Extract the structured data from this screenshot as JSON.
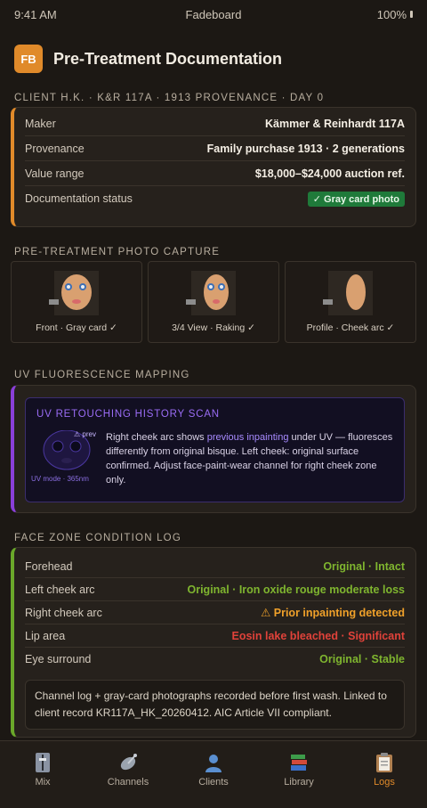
{
  "status": {
    "time": "9:41 AM",
    "app_name": "Fadeboard",
    "battery": "100%"
  },
  "header": {
    "logo": "FB",
    "title": "Pre-Treatment Documentation"
  },
  "client": {
    "label": "CLIENT H.K. · K&R 117A · 1913 PROVENANCE · DAY 0",
    "rows": [
      {
        "k": "Maker",
        "v": "Kämmer & Reinhardt 117A"
      },
      {
        "k": "Provenance",
        "v": "Family purchase 1913 · 2 generations"
      },
      {
        "k": "Value range",
        "v": "$18,000–$24,000 auction ref."
      },
      {
        "k": "Documentation status",
        "v": "✓ Gray card photo"
      }
    ]
  },
  "photo_capture": {
    "label": "PRE-TREATMENT PHOTO CAPTURE",
    "photos": [
      {
        "label": "Front · Gray card ✓"
      },
      {
        "label": "3/4 View · Raking ✓"
      },
      {
        "label": "Profile · Cheek arc ✓"
      }
    ]
  },
  "uv": {
    "label": "UV FLUORESCENCE MAPPING",
    "panel_title": "UV RETOUCHING HISTORY SCAN",
    "figure_prev": "⚠ prev",
    "figure_caption": "UV mode · 365nm",
    "text_before": "Right cheek arc shows ",
    "text_highlight": "previous inpainting",
    "text_after": " under UV — fluoresces differently from original bisque. Left cheek: original surface confirmed. Adjust face-paint-wear channel for right cheek zone only."
  },
  "zones": {
    "label": "FACE ZONE CONDITION LOG",
    "rows": [
      {
        "k": "Forehead",
        "v": "Original · Intact",
        "color": "#7fb52f"
      },
      {
        "k": "Left cheek arc",
        "v": "Original · Iron oxide rouge moderate loss",
        "color": "#7fb52f"
      },
      {
        "k": "Right cheek arc",
        "v": "⚠ Prior inpainting detected",
        "color": "#f0a12a"
      },
      {
        "k": "Lip area",
        "v": "Eosin lake bleached · Significant",
        "color": "#e0423a"
      },
      {
        "k": "Eye surround",
        "v": "Original · Stable",
        "color": "#7fb52f"
      }
    ],
    "note": "Channel log + gray-card photographs recorded before first wash. Linked to client record KR117A_HK_20260412. AIC Article VII compliant."
  },
  "tabs": [
    {
      "label": "Mix",
      "icon": "mixer-icon"
    },
    {
      "label": "Channels",
      "icon": "satellite-icon"
    },
    {
      "label": "Clients",
      "icon": "person-icon"
    },
    {
      "label": "Library",
      "icon": "books-icon"
    },
    {
      "label": "Logs",
      "icon": "clipboard-icon",
      "active": true
    }
  ]
}
